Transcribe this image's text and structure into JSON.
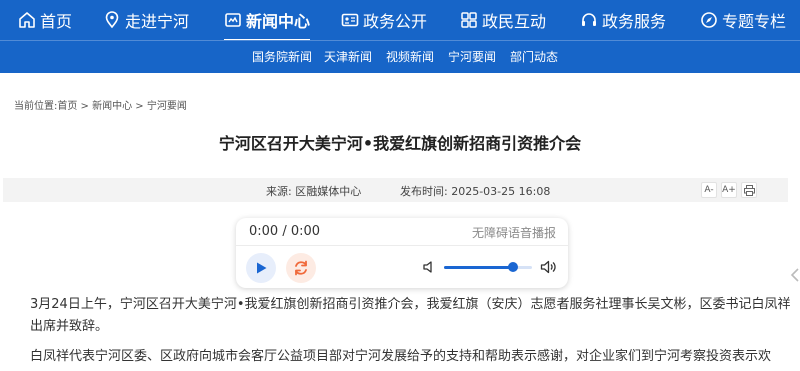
{
  "nav": {
    "items": [
      {
        "label": "首页",
        "icon": "home-icon"
      },
      {
        "label": "走进宁河",
        "icon": "location-icon"
      },
      {
        "label": "新闻中心",
        "icon": "news-icon",
        "active": true
      },
      {
        "label": "政务公开",
        "icon": "id-card-icon"
      },
      {
        "label": "政民互动",
        "icon": "interaction-icon"
      },
      {
        "label": "政务服务",
        "icon": "headset-icon"
      },
      {
        "label": "专题专栏",
        "icon": "compass-icon"
      }
    ]
  },
  "subnav": {
    "items": [
      "国务院新闻",
      "天津新闻",
      "视频新闻",
      "宁河要闻",
      "部门动态"
    ]
  },
  "breadcrumb": {
    "prefix": "当前位置:",
    "home": "首页",
    "sep1": " > ",
    "news": "新闻中心",
    "sep2": " > ",
    "current": "宁河要闻"
  },
  "article": {
    "title": "宁河区召开大美宁河•我爱红旗创新招商引资推介会",
    "source": "来源:  区融媒体中心",
    "publish_time": "发布时间: 2025-03-25 16:08",
    "tools": {
      "font_smaller": "A-",
      "font_larger": "A+",
      "print": "print-icon"
    },
    "paragraph1": "3月24日上午，宁河区召开大美宁河•我爱红旗创新招商引资推介会，我爱红旗（安庆）志愿者服务社理事长吴文彬，区委书记白凤祥出席并致辞。",
    "paragraph2": "白凤祥代表宁河区委、区政府向城市会客厅公益项目部对宁河发展给予的支持和帮助表示感谢，对企业家们到宁河考察投资表示欢"
  },
  "player": {
    "time": "0:00 / 0:00",
    "hint": "无障碍语音播报",
    "volume_fraction": 0.78
  },
  "colors": {
    "primary": "#1765c8",
    "accent": "#1a66d2",
    "loop": "#f0693a"
  }
}
